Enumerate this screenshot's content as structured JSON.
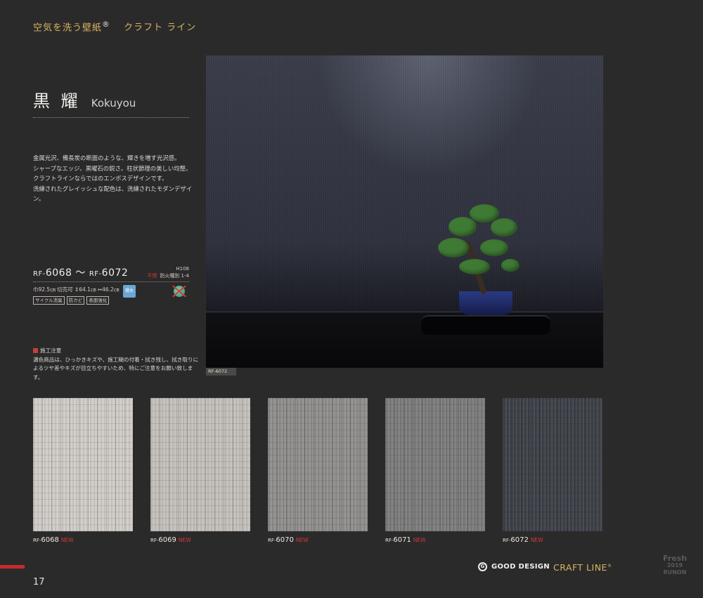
{
  "header": {
    "brand": "空気を洗う壁紙",
    "mark": "®",
    "line": "クラフト ライン"
  },
  "title": {
    "jp": "黒 耀",
    "en": "Kokuyou"
  },
  "description": [
    "金属光沢、備長炭の断面のような、輝きを増す光沢感。",
    "シャープなエッジ、黒曜石の鋭さ。柱状節理の美しい均整。",
    "クラフトラインならではのエンボスデザインです。",
    "洗練されたグレイッシュな配色は、洗練されたモダンデザイン。"
  ],
  "spec": {
    "model_prefix_1": "RF-",
    "model_num_1": "6068",
    "tilde": "～",
    "model_prefix_2": "RF-",
    "model_num_2": "6072",
    "fire_code": "H108",
    "fire_note_red": "不燃",
    "fire_class": "防火種別 1-4",
    "size": "巾92.5㎝ 切売可 ↕64.1㎝ ↔46.2㎝",
    "badges": [
      "サイクル消臭",
      "防カビ",
      "表面強化"
    ],
    "blue_icon_text": "撥水"
  },
  "note": {
    "heading": "施工注意",
    "lines": [
      "濃色商品は、ひっかきキズや、施工糊の付着・拭き残し、拭き取りに",
      "よるツヤ差やキズが目立ちやすいため、特にご注意をお願い致します。"
    ]
  },
  "photo": {
    "caption": "RF-6072"
  },
  "swatches": [
    {
      "prefix": "RF-",
      "number": "6068",
      "badge": "NEW",
      "color": "#cfccc7"
    },
    {
      "prefix": "RF-",
      "number": "6069",
      "badge": "NEW",
      "color": "#c3c0bb"
    },
    {
      "prefix": "RF-",
      "number": "6070",
      "badge": "NEW",
      "color": "#8e8d8c"
    },
    {
      "prefix": "RF-",
      "number": "6071",
      "badge": "NEW",
      "color": "#7b7b7b"
    },
    {
      "prefix": "RF-",
      "number": "6072",
      "badge": "NEW",
      "color": "#3c3f46"
    }
  ],
  "footer": {
    "page": "17",
    "good_design": "GOOD DESIGN",
    "good_design_mark": "G",
    "craft_line": "CRAFT LINE",
    "craft_mark": "®",
    "fresh": "Fresh",
    "year": "2019",
    "runon": "RUNON"
  },
  "colors": {
    "background": "#2b2a2a",
    "gold": "#d7b463",
    "accent_red": "#d43a36"
  }
}
